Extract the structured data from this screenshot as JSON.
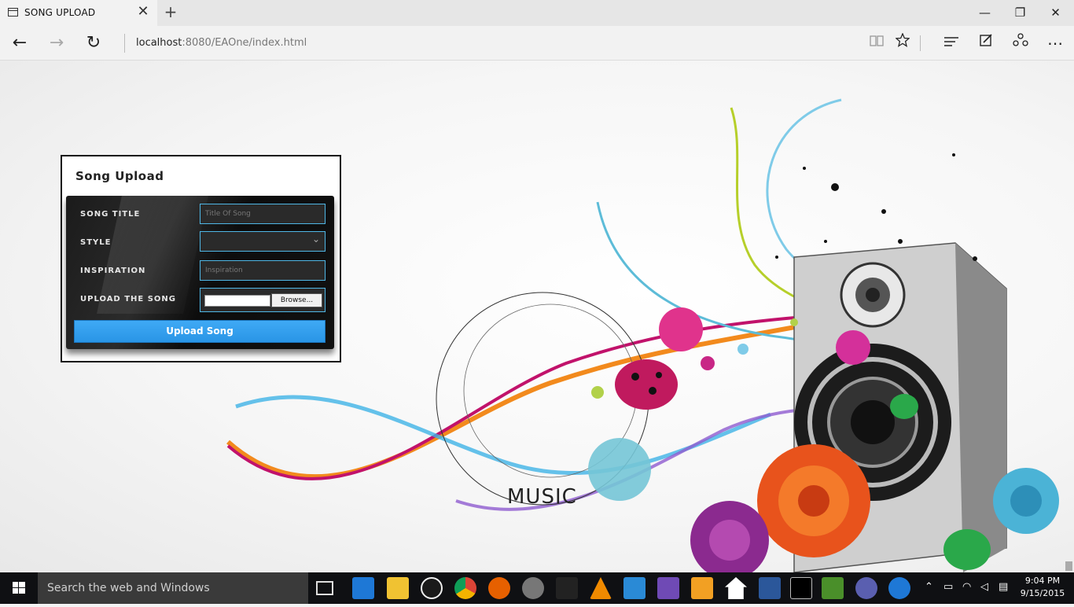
{
  "browser": {
    "tab_title": "SONG UPLOAD",
    "tab_close": "✕",
    "new_tab": "+",
    "url_host": "localhost",
    "url_rest": ":8080/EAOne/index.html",
    "nav": {
      "back": "←",
      "forward": "→",
      "refresh": "↻"
    },
    "window": {
      "minimize": "—",
      "restore": "❐",
      "close": "✕"
    }
  },
  "form": {
    "title": "Song Upload",
    "fields": [
      {
        "label": "SONG TITLE",
        "placeholder": "Title Of Song"
      },
      {
        "label": "STYLE",
        "value": ""
      },
      {
        "label": "INSPIRATION",
        "placeholder": "Inspiration"
      },
      {
        "label": "UPLOAD THE SONG",
        "button": "Browse..."
      }
    ],
    "submit_label": "Upload Song"
  },
  "artwork": {
    "text": "MUSIC"
  },
  "taskbar": {
    "search_placeholder": "Search the web and Windows",
    "time": "9:04 PM",
    "date": "9/15/2015",
    "colors": {
      "accent": "#3fa9f5",
      "taskbar": "#0f1013"
    }
  }
}
